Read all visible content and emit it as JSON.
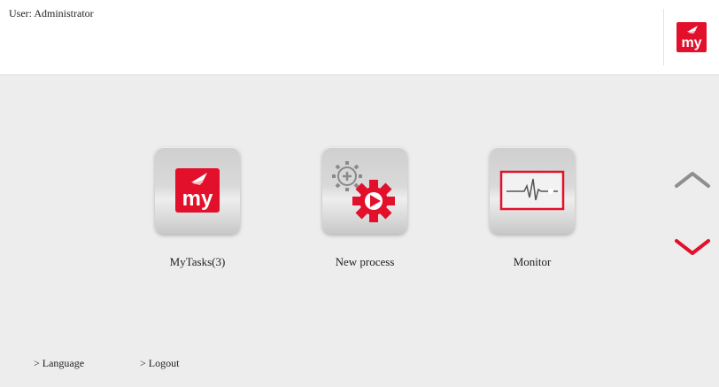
{
  "header": {
    "user_label": "User: Administrator",
    "logo_text": "my"
  },
  "tiles": [
    {
      "label": "MyTasks(3)",
      "icon": "mytasks-icon"
    },
    {
      "label": "New process",
      "icon": "new-process-gear-icon"
    },
    {
      "label": "Monitor",
      "icon": "monitor-pulse-icon"
    }
  ],
  "nav": {
    "up_icon": "chevron-up-icon",
    "down_icon": "chevron-down-icon"
  },
  "footer": {
    "language_label": "> Language",
    "logout_label": "> Logout"
  },
  "colors": {
    "brand_red": "#e2102a",
    "background": "#ededed",
    "header_bg": "#ffffff",
    "chevron_gray": "#8f8f8f"
  }
}
